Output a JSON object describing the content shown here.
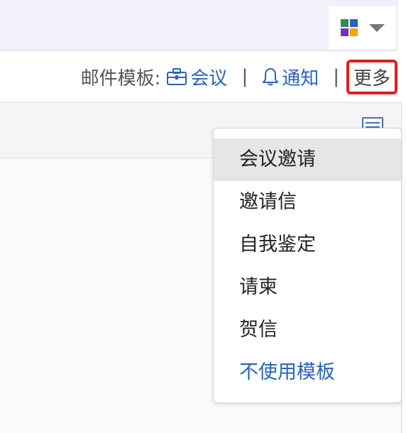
{
  "colors": {
    "accent_link": "#2a63b8",
    "highlight_border": "#e11e1e",
    "apps_grid": [
      "#2e8b57",
      "#2a63b8",
      "#7b2fb8",
      "#f4a300"
    ]
  },
  "topbar": {
    "apps_icon": "apps-grid-icon",
    "dropdown_icon": "caret-down-icon"
  },
  "template_bar": {
    "label": "邮件模板:",
    "meeting": {
      "icon": "briefcase-icon",
      "label": "会议"
    },
    "separator": "|",
    "notice": {
      "icon": "bell-icon",
      "label": "通知"
    },
    "more": "更多"
  },
  "menu": {
    "items": [
      {
        "label": "会议邀请"
      },
      {
        "label": "邀请信"
      },
      {
        "label": "自我鉴定"
      },
      {
        "label": "请柬"
      },
      {
        "label": "贺信"
      },
      {
        "label": "不使用模板"
      }
    ]
  }
}
